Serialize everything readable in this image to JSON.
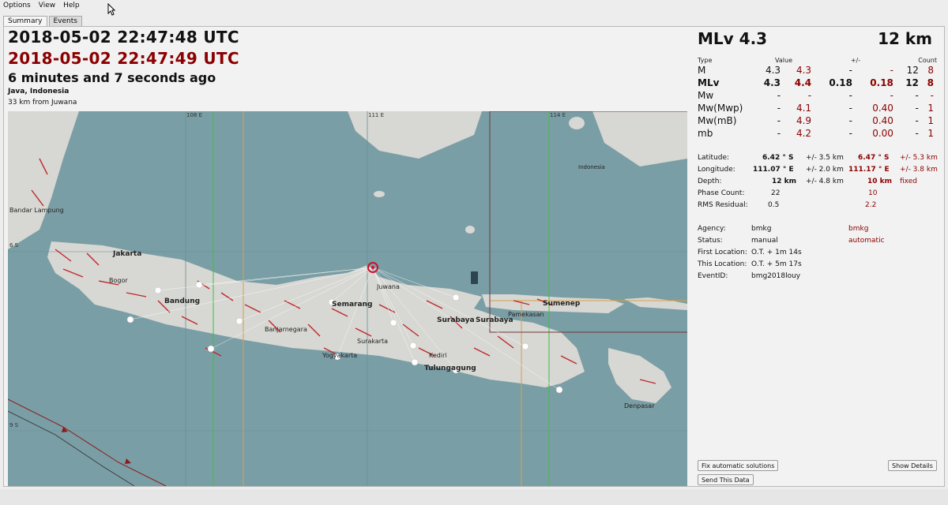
{
  "menu": {
    "options": "Options",
    "view": "View",
    "help": "Help"
  },
  "tabs": [
    {
      "label": "Summary"
    },
    {
      "label": "Events"
    }
  ],
  "event": {
    "origin_time": "2018-05-02 22:47:48 UTC",
    "origin_time_alt": "2018-05-02 22:47:49 UTC",
    "ago": "6 minutes and 7 seconds ago",
    "region": "Java, Indonesia",
    "nearest": "33 km from Juwana"
  },
  "summary": {
    "magnitude": "MLv 4.3",
    "depth": "12 km"
  },
  "mag_table": {
    "headers": {
      "type": "Type",
      "value": "Value",
      "pm": "+/-",
      "count": "Count"
    },
    "rows": [
      {
        "type": "M",
        "v1": "4.3",
        "v2": "4.3",
        "e1": "-",
        "e2": "-",
        "c1": "12",
        "c2": "8",
        "bold": false
      },
      {
        "type": "MLv",
        "v1": "4.3",
        "v2": "4.4",
        "e1": "0.18",
        "e2": "0.18",
        "c1": "12",
        "c2": "8",
        "bold": true
      },
      {
        "type": "Mw",
        "v1": "-",
        "v2": "-",
        "e1": "-",
        "e2": "-",
        "c1": "-",
        "c2": "-",
        "bold": false
      },
      {
        "type": "Mw(Mwp)",
        "v1": "-",
        "v2": "4.1",
        "e1": "-",
        "e2": "0.40",
        "c1": "-",
        "c2": "1",
        "bold": false
      },
      {
        "type": "Mw(mB)",
        "v1": "-",
        "v2": "4.9",
        "e1": "-",
        "e2": "0.40",
        "c1": "-",
        "c2": "1",
        "bold": false
      },
      {
        "type": "mb",
        "v1": "-",
        "v2": "4.2",
        "e1": "-",
        "e2": "0.00",
        "c1": "-",
        "c2": "1",
        "bold": false
      }
    ]
  },
  "location": {
    "latitude": {
      "label": "Latitude:",
      "v1": "6.42 ° S",
      "e1": "+/- 3.5 km",
      "v2": "6.47 ° S",
      "e2": "+/- 5.3 km"
    },
    "longitude": {
      "label": "Longitude:",
      "v1": "111.07 ° E",
      "e1": "+/- 2.0 km",
      "v2": "111.17 ° E",
      "e2": "+/- 3.8 km"
    },
    "depth": {
      "label": "Depth:",
      "v1": "12 km",
      "e1": "+/- 4.8 km",
      "v2": "10 km",
      "e2": "fixed"
    },
    "phase": {
      "label": "Phase Count:",
      "v1": "22",
      "v2": "10"
    },
    "rms": {
      "label": "RMS Residual:",
      "v1": "0.5",
      "v2": "2.2"
    }
  },
  "origin_info": {
    "agency": {
      "label": "Agency:",
      "v1": "bmkg",
      "v2": "bmkg"
    },
    "status": {
      "label": "Status:",
      "v1": "manual",
      "v2": "automatic"
    },
    "first_location": {
      "label": "First Location:",
      "v1": "O.T. + 1m 14s"
    },
    "this_location": {
      "label": "This Location:",
      "v1": "O.T. + 5m 17s"
    },
    "event_id": {
      "label": "EventID:",
      "v1": "bmg2018louy"
    }
  },
  "buttons": {
    "fix": "Fix automatic solutions",
    "show": "Show Details",
    "send": "Send This Data"
  },
  "map": {
    "grid": {
      "lon1": "108 E",
      "lon2": "111 E",
      "lon3": "114 E",
      "lat1": "6 S",
      "lat2": "9 S"
    },
    "places": {
      "bandar_lampung": "Bandar Lampung",
      "jakarta": "Jakarta",
      "bogor": "Bogor",
      "bandung": "Bandung",
      "banjarnegara": "Banjarnegara",
      "semarang": "Semarang",
      "juwana": "Juwana",
      "surakarta": "Surakarta",
      "yogyakarta": "Yogyakarta",
      "surabaya": "Surabaya",
      "surabaya2": "Surabaya",
      "kediri": "Kediri",
      "tulungagung": "Tulungagung",
      "sumenep": "Sumenep",
      "pamekasan": "Pamekasan",
      "denpasar": "Denpasar",
      "indonesia": "Indonesia"
    },
    "colors": {
      "sea": "#7a9ea5",
      "land": "#d7d7d3",
      "fault": "#c0282d",
      "epicenter": "#d0102a"
    }
  }
}
